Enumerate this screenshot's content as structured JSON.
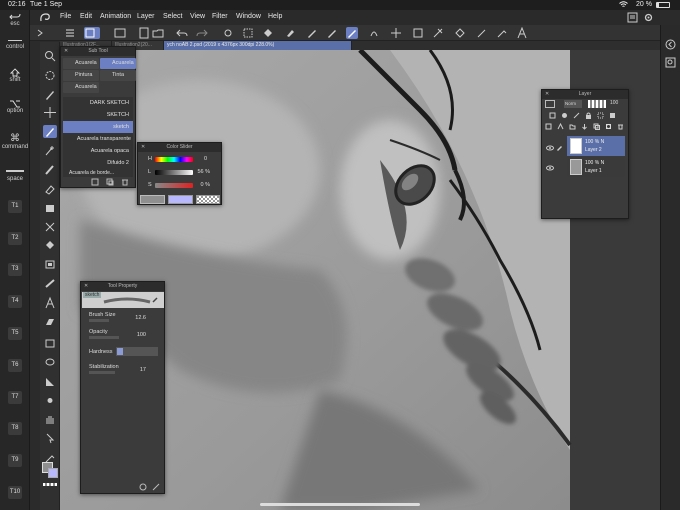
{
  "status": {
    "time": "02:16",
    "date": "Tue 1 Sep",
    "battery": "20 %",
    "battery_fraction": 0.2
  },
  "menu": [
    "File",
    "Edit",
    "Animation",
    "Layer",
    "Select",
    "View",
    "Filter",
    "Window",
    "Help"
  ],
  "left_keys": {
    "esc": "esc",
    "control": "control",
    "shift": "shift",
    "option": "option",
    "command": "command",
    "space": "space",
    "t_keys": [
      "T1",
      "T2",
      "T3",
      "T4",
      "T5",
      "T6",
      "T7",
      "T8",
      "T9",
      "T10"
    ]
  },
  "tabs": [
    "Illustration1(2F...",
    "Illustration2(20...",
    "ych noAB 2.psd (2019 x 4376px 300dpi 228.0%)"
  ],
  "sub_tool": {
    "title": "Sub Tool",
    "tabs": [
      "Acuarela",
      "Acuarela",
      "Pintura",
      "Tinta",
      "Acuarela"
    ],
    "brushes": [
      "DARK SKETCH",
      "SKETCH",
      "sketch",
      "Acuarela transparente",
      "Acuarela opaca",
      "Difuido 2",
      "Acuarela de borde..."
    ]
  },
  "color_slider": {
    "title": "Color Slider",
    "rows": [
      {
        "label": "H",
        "value": "0"
      },
      {
        "label": "L",
        "value": "56 %"
      },
      {
        "label": "S",
        "value": "0 %"
      }
    ],
    "main_color": "#8f8f8f",
    "sub_color": "#b8b8ff"
  },
  "tool_property": {
    "title": "Tool Property",
    "brush_name": "sketch",
    "props": [
      {
        "label": "Brush Size",
        "value": "12.6"
      },
      {
        "label": "Opacity",
        "value": "100"
      },
      {
        "label": "Hardness",
        "value": ""
      },
      {
        "label": "Stabilization",
        "value": "17"
      }
    ]
  },
  "layer": {
    "title": "Layer",
    "blend": "Norm",
    "opacity": "100",
    "layers": [
      {
        "percent": "100 % N",
        "name": "Layer 2"
      },
      {
        "percent": "100 % N",
        "name": "Layer 1"
      }
    ]
  },
  "colors": {
    "accent": "#6b7fc2"
  }
}
